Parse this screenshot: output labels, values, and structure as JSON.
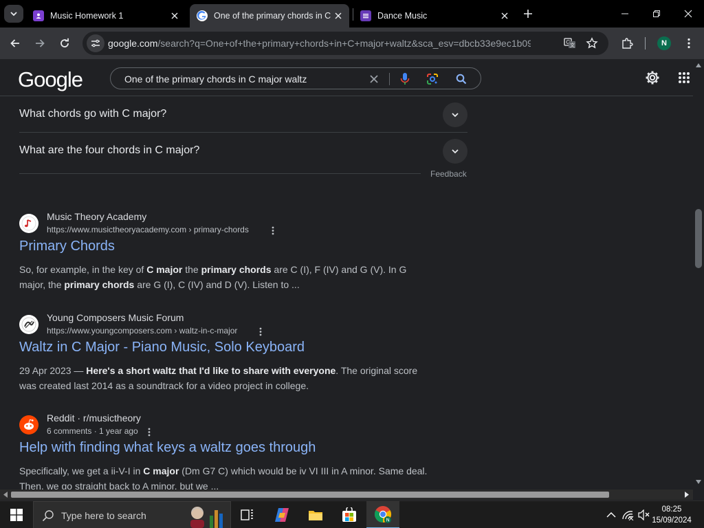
{
  "browser": {
    "tabs": [
      {
        "label": "Music Homework 1",
        "icon": "assignment-icon",
        "icon_color": "#7b3fd1",
        "active": false
      },
      {
        "label": "One of the primary chords in C",
        "icon": "google-icon",
        "active": true
      },
      {
        "label": "Dance Music",
        "icon": "form-icon",
        "icon_color": "#673ab7",
        "active": false
      }
    ],
    "url_host": "google.com",
    "url_path": "/search?q=One+of+the+primary+chords+in+C+major+waltz&sca_esv=dbcb33e9ec1b098b...",
    "profile_initial": "N",
    "profile_color": "#0b6e4f"
  },
  "google": {
    "logo": "Google",
    "query": "One of the primary chords in C major waltz"
  },
  "faqs": [
    {
      "question": "What chords go with C major?"
    },
    {
      "question": "What are the four chords in C major?"
    }
  ],
  "feedback_label": "Feedback",
  "results": [
    {
      "site": "Music Theory Academy",
      "url": "https://www.musictheoryacademy.com › primary-chords",
      "title": "Primary Chords",
      "snippet": [
        {
          "t": "So, for example, in the key of ",
          "b": false
        },
        {
          "t": "C major",
          "b": true
        },
        {
          "t": " the ",
          "b": false
        },
        {
          "t": "primary chords",
          "b": true
        },
        {
          "t": " are C (I), F (IV) and G (V). In G major, the ",
          "b": false
        },
        {
          "t": "primary chords",
          "b": true
        },
        {
          "t": " are G (I), C (IV) and D (V). Listen to ...",
          "b": false
        }
      ]
    },
    {
      "site": "Young Composers Music Forum",
      "url": "https://www.youngcomposers.com › waltz-in-c-major",
      "title": "Waltz in C Major - Piano Music, Solo Keyboard",
      "snippet": [
        {
          "t": "29 Apr 2023 — ",
          "b": false
        },
        {
          "t": "Here's a short waltz that I'd like to share with everyone",
          "b": true
        },
        {
          "t": ". The original score was created last 2014 as a soundtrack for a video project in college.",
          "b": false
        }
      ]
    },
    {
      "site": "Reddit · r/musictheory",
      "url": "6 comments · 1 year ago",
      "title": "Help with finding what keys a waltz goes through",
      "snippet": [
        {
          "t": "Specifically, we get a ii-V-I in ",
          "b": false
        },
        {
          "t": "C major",
          "b": true
        },
        {
          "t": " (Dm G7 C) which would be iv VI III in A minor. Same deal. Then, we go straight back to A minor, but we ...",
          "b": false
        }
      ]
    }
  ],
  "taskbar": {
    "search_placeholder": "Type here to search",
    "time": "08:25",
    "date": "15/09/2024"
  }
}
